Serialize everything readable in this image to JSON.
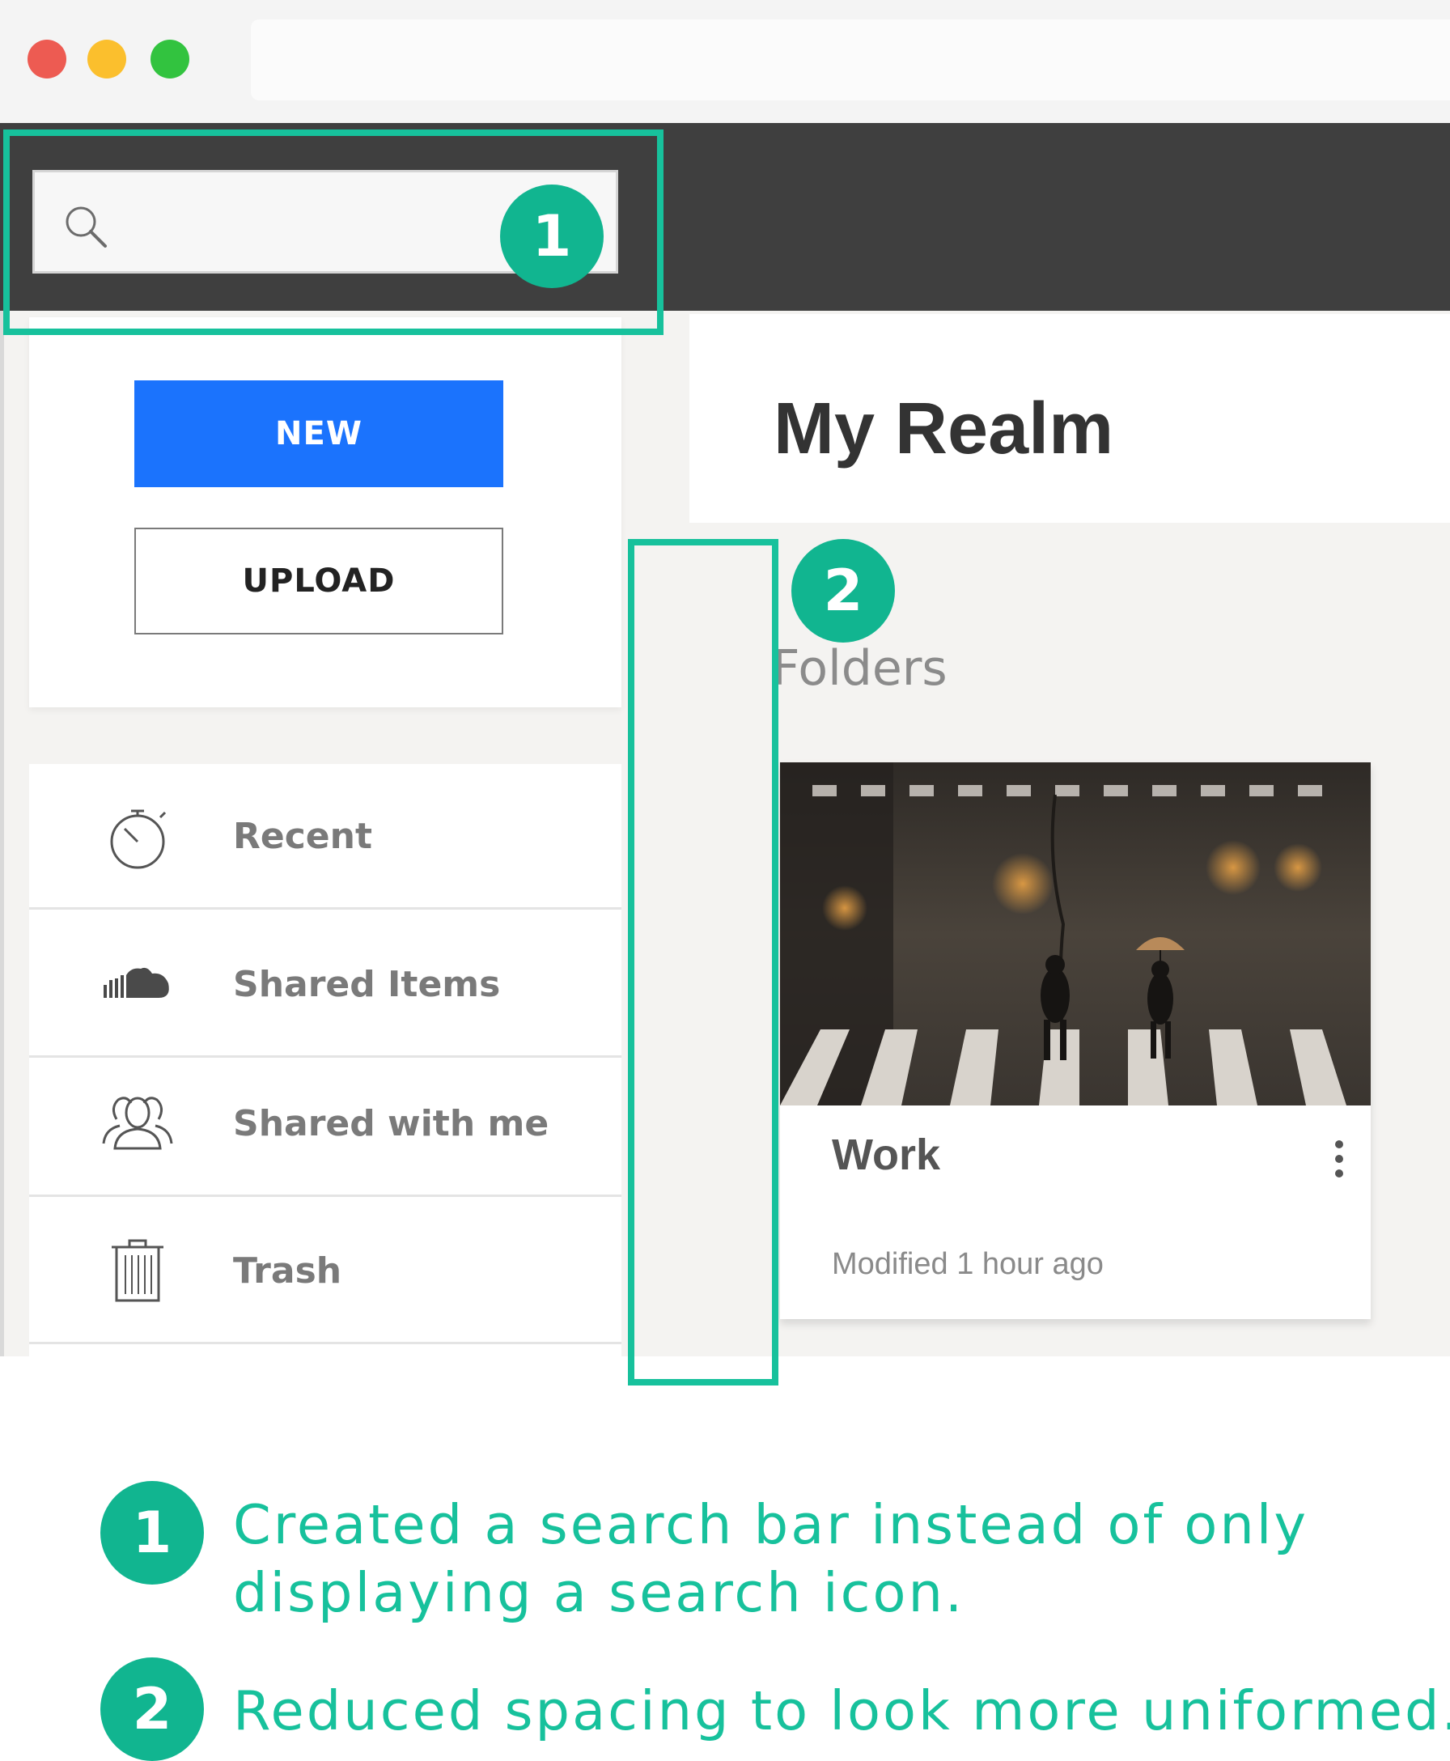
{
  "window": {
    "controls": [
      "close",
      "minimize",
      "zoom"
    ],
    "colors": {
      "close": "#ed5b52",
      "minimize": "#fbbf2d",
      "zoom": "#32c33f"
    }
  },
  "search": {
    "placeholder": "",
    "icon": "search-icon"
  },
  "sidebar": {
    "new_label": "NEW",
    "upload_label": "UPLOAD",
    "items": [
      {
        "label": "Recent",
        "icon": "stopwatch-icon"
      },
      {
        "label": "Shared Items",
        "icon": "cloud-icon"
      },
      {
        "label": "Shared with me",
        "icon": "users-icon"
      },
      {
        "label": "Trash",
        "icon": "trash-icon"
      }
    ]
  },
  "main": {
    "title": "My Realm",
    "folders_heading": "Folders",
    "folders": [
      {
        "name": "Work",
        "modified": "Modified 1 hour ago",
        "thumbnail": "rainy-crosswalk-photo"
      }
    ]
  },
  "annotations": {
    "markers": [
      "1",
      "2"
    ],
    "notes": [
      {
        "number": "1",
        "line1": "Created a search bar instead of only",
        "line2": "displaying a search icon."
      },
      {
        "number": "2",
        "line1": "Reduced spacing to look more uniformed."
      }
    ]
  },
  "colors": {
    "accent": "#11b590",
    "primary_button": "#1b73fd",
    "topbar": "#3f3f3f"
  }
}
